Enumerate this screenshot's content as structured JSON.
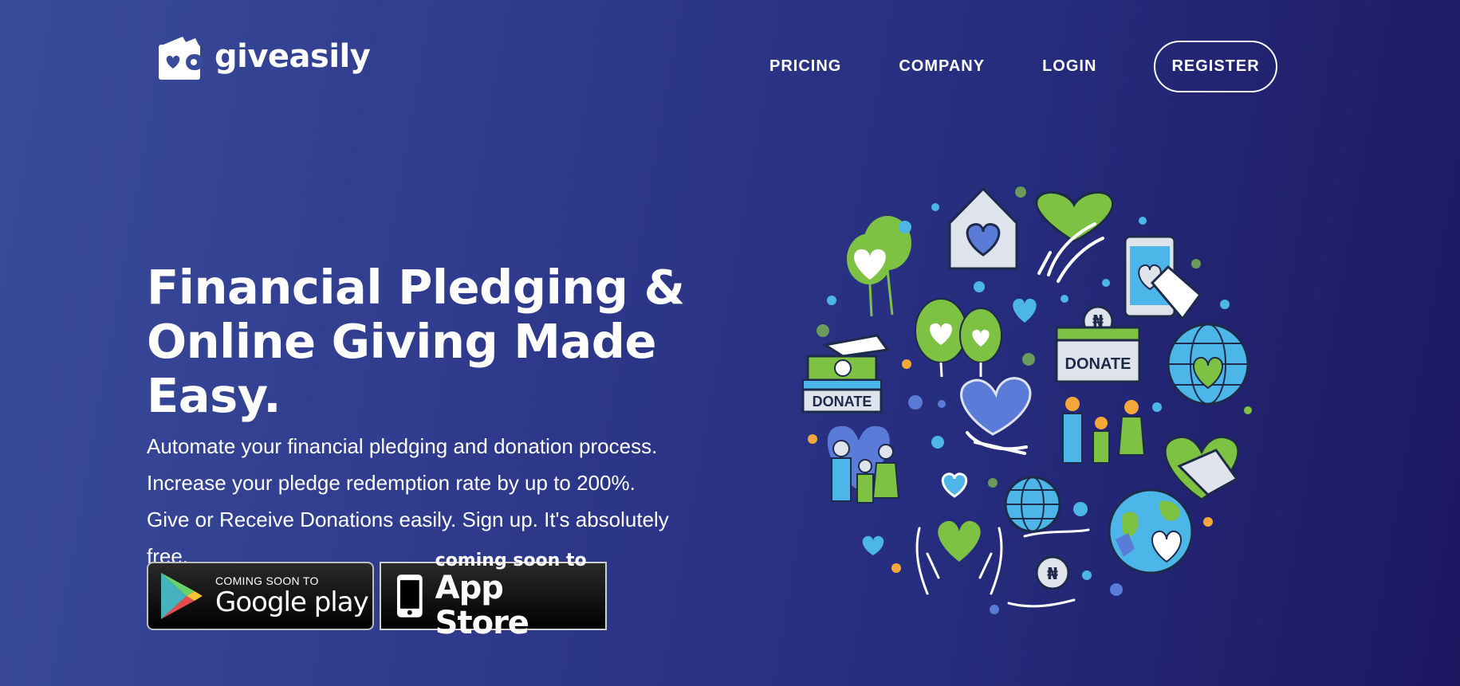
{
  "brand": {
    "name": "giveasily"
  },
  "nav": {
    "pricing": "PRICING",
    "company": "COMPANY",
    "login": "LOGIN",
    "register": "REGISTER"
  },
  "hero": {
    "title_line1": "Financial Pledging &",
    "title_line2": "Online Giving Made Easy.",
    "line1": "Automate your financial pledging and donation process.",
    "line2": "Increase your pledge redemption rate by up to 200%.",
    "line3": "Give or Receive Donations easily. Sign up. It's absolutely free."
  },
  "stores": {
    "google": {
      "small": "COMING SOON TO",
      "big": "Google play"
    },
    "apple": {
      "small": "coming soon to",
      "big": "App Store"
    }
  },
  "illustration": {
    "donate_label_1": "DONATE",
    "donate_label_2": "DONATE",
    "coin_symbol_1": "₦",
    "coin_symbol_2": "₦"
  },
  "colors": {
    "green": "#7dc242",
    "blue": "#5b7bd8",
    "light_blue": "#4db6e8",
    "outline": "#1e2a4a",
    "white": "#ffffff"
  }
}
